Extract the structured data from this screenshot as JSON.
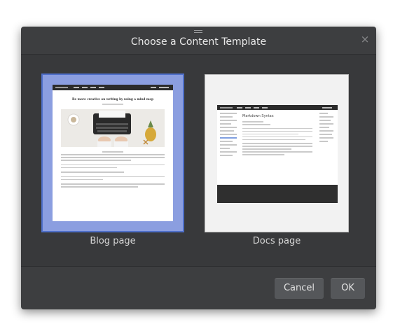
{
  "dialog": {
    "title": "Choose a Content Template",
    "close_symbol": "×"
  },
  "templates": [
    {
      "label": "Blog page",
      "selected": true
    },
    {
      "label": "Docs page",
      "selected": false
    }
  ],
  "blog_preview": {
    "heading": "Be more creative on writing by using a mind map"
  },
  "docs_preview": {
    "heading": "Markdown Syntax"
  },
  "buttons": {
    "cancel": "Cancel",
    "ok": "OK"
  },
  "colors": {
    "selection_fill": "#8b9ee0",
    "selection_border": "#4f6fc9",
    "dialog_bg": "#3d3e40"
  }
}
